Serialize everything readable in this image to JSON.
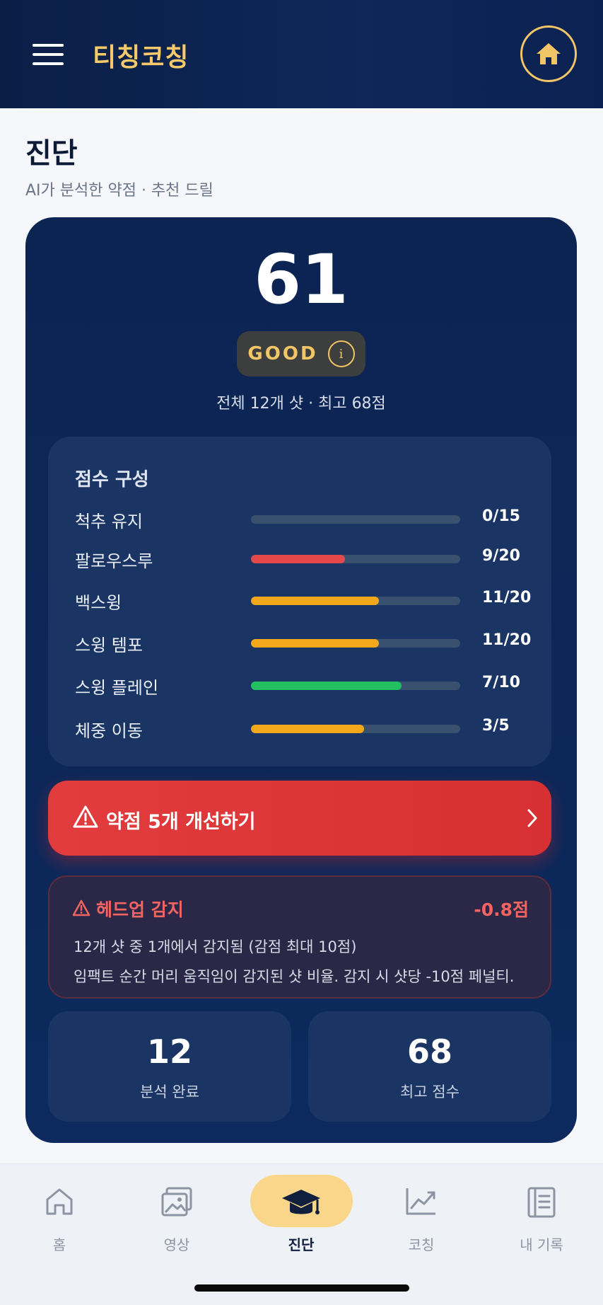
{
  "header": {
    "brand": "티칭코칭",
    "menu_icon": "hamburger-menu-icon",
    "home_icon": "home-icon"
  },
  "page": {
    "title": "진단",
    "subtitle": "AI가 분석한 약점 · 추천 드릴"
  },
  "score": {
    "value": "61",
    "grade": "GOOD",
    "summary": "전체 12개 샷 · 최고 68점"
  },
  "breakdown": {
    "title": "점수 구성",
    "items": [
      {
        "label": "척추 유지",
        "value": "0/15",
        "fraction": 0.0,
        "color": "#3a506f"
      },
      {
        "label": "팔로우스루",
        "value": "9/20",
        "fraction": 0.45,
        "color": "#e54848"
      },
      {
        "label": "백스윙",
        "value": "11/20",
        "fraction": 0.61,
        "color": "#f2a81a"
      },
      {
        "label": "스윙 템포",
        "value": "11/20",
        "fraction": 0.61,
        "color": "#f2a81a"
      },
      {
        "label": "스윙 플레인",
        "value": "7/10",
        "fraction": 0.72,
        "color": "#23c062"
      },
      {
        "label": "체중 이동",
        "value": "3/5",
        "fraction": 0.54,
        "color": "#f2a81a"
      }
    ]
  },
  "cta": {
    "label": "약점 5개 개선하기",
    "icon": "warning-icon"
  },
  "headup": {
    "title": "헤드업 감지",
    "penalty": "-0.8점",
    "line1": "12개 샷 중 1개에서 감지됨 (감점 최대 10점)",
    "line2": "임팩트 순간 머리 움직임이 감지된 샷 비율. 감지 시 샷당 -10점 페널티."
  },
  "stats": [
    {
      "value": "12",
      "label": "분석 완료"
    },
    {
      "value": "68",
      "label": "최고 점수"
    }
  ],
  "nav": {
    "items": [
      {
        "label": "홈",
        "icon": "home-icon"
      },
      {
        "label": "영상",
        "icon": "gallery-icon"
      },
      {
        "label": "진단",
        "icon": "graduation-cap-icon",
        "active": true
      },
      {
        "label": "코칭",
        "icon": "chart-line-icon"
      },
      {
        "label": "내 기록",
        "icon": "notebook-icon"
      }
    ]
  },
  "colors": {
    "accent": "#f2c566",
    "card_bg": "#0c2452",
    "danger": "#e23c3e"
  }
}
